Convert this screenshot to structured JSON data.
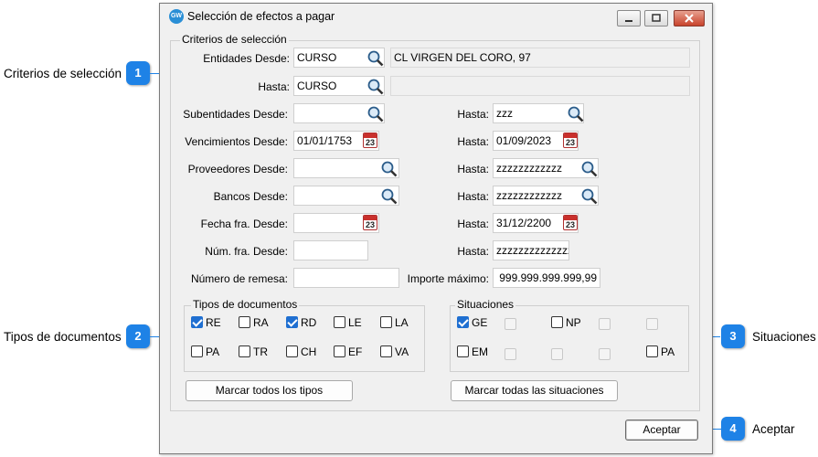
{
  "window": {
    "title": "Selección de efectos a pagar",
    "icon_text": "GW",
    "icon_color": "#2a8fd6",
    "controls": [
      "minimize-icon",
      "maximize-icon",
      "close-icon"
    ]
  },
  "criteria": {
    "legend": "Criterios de selección",
    "entidades_desde_label": "Entidades  Desde:",
    "entidades_desde_value": "CURSO",
    "entidades_desde_desc": "CL VIRGEN DEL CORO, 97",
    "entidades_hasta_label": "Hasta:",
    "entidades_hasta_value": "CURSO",
    "entidades_hasta_desc": "",
    "rows": [
      {
        "desde_label": "Subentidades Desde:",
        "desde_value": "",
        "desde_icon": "search-icon",
        "hasta_label": "Hasta:",
        "hasta_value": "zzz",
        "hasta_icon": "search-icon"
      },
      {
        "desde_label": "Vencimientos Desde:",
        "desde_value": "01/01/1753",
        "desde_icon": "calendar-icon",
        "hasta_label": "Hasta:",
        "hasta_value": "01/09/2023",
        "hasta_icon": "calendar-icon"
      },
      {
        "desde_label": "Proveedores Desde:",
        "desde_value": "",
        "desde_icon": "search-icon",
        "hasta_label": "Hasta:",
        "hasta_value": "zzzzzzzzzzzz",
        "hasta_icon": "search-icon"
      },
      {
        "desde_label": "Bancos Desde:",
        "desde_value": "",
        "desde_icon": "search-icon",
        "hasta_label": "Hasta:",
        "hasta_value": "zzzzzzzzzzzz",
        "hasta_icon": "search-icon"
      },
      {
        "desde_label": "Fecha fra. Desde:",
        "desde_value": "",
        "desde_icon": "calendar-icon",
        "hasta_label": "Hasta:",
        "hasta_value": "31/12/2200",
        "hasta_icon": "calendar-icon"
      },
      {
        "desde_label": "Núm. fra. Desde:",
        "desde_value": "",
        "desde_icon": "",
        "hasta_label": "Hasta:",
        "hasta_value": "zzzzzzzzzzzzzzz",
        "hasta_icon": ""
      }
    ],
    "remesa_label": "Número de remesa:",
    "remesa_value": "",
    "importe_label": "Importe máximo:",
    "importe_value": "999.999.999.999,99",
    "calendar_day": "23"
  },
  "tipos": {
    "legend": "Tipos de documentos",
    "items": [
      {
        "label": "RE",
        "checked": true
      },
      {
        "label": "RA",
        "checked": false
      },
      {
        "label": "RD",
        "checked": true
      },
      {
        "label": "LE",
        "checked": false
      },
      {
        "label": "LA",
        "checked": false
      },
      {
        "label": "PA",
        "checked": false
      },
      {
        "label": "TR",
        "checked": false
      },
      {
        "label": "CH",
        "checked": false
      },
      {
        "label": "EF",
        "checked": false
      },
      {
        "label": "VA",
        "checked": false
      }
    ],
    "button": "Marcar todos los tipos"
  },
  "situaciones": {
    "legend": "Situaciones",
    "items": [
      {
        "label": "GE",
        "checked": true,
        "enabled": true
      },
      {
        "label": "",
        "checked": false,
        "enabled": false
      },
      {
        "label": "NP",
        "checked": false,
        "enabled": true
      },
      {
        "label": "",
        "checked": false,
        "enabled": false
      },
      {
        "label": "",
        "checked": false,
        "enabled": false
      },
      {
        "label": "EM",
        "checked": false,
        "enabled": true
      },
      {
        "label": "",
        "checked": false,
        "enabled": false
      },
      {
        "label": "",
        "checked": false,
        "enabled": false
      },
      {
        "label": "",
        "checked": false,
        "enabled": false
      },
      {
        "label": "PA",
        "checked": false,
        "enabled": true
      }
    ],
    "button": "Marcar todas las situaciones"
  },
  "accept_button": "Aceptar",
  "callouts": [
    {
      "number": "1",
      "text": "Criterios de selección"
    },
    {
      "number": "2",
      "text": "Tipos de documentos"
    },
    {
      "number": "3",
      "text": "Situaciones"
    },
    {
      "number": "4",
      "text": "Aceptar"
    }
  ],
  "accent_color": "#1e82e6"
}
